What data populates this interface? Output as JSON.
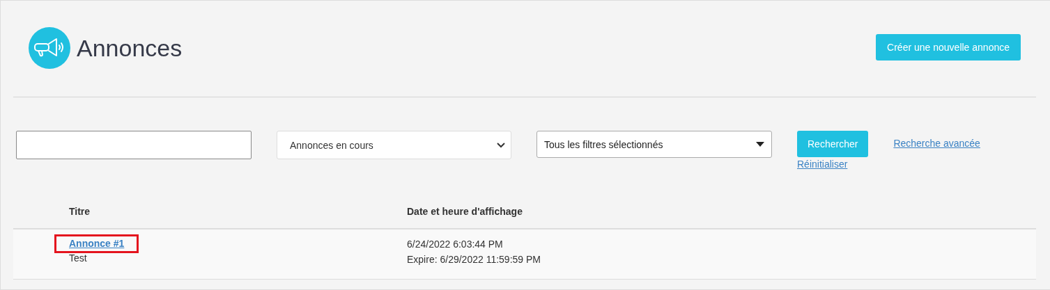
{
  "page": {
    "title": "Annonces",
    "create_button": "Créer une nouvelle annonce"
  },
  "filters": {
    "status_select": {
      "value": "Annonces en cours"
    },
    "filter_select": {
      "value": "Tous les filtres sélectionnés"
    },
    "search_button": "Rechercher",
    "advanced_link": "Recherche avancée",
    "reset_link": "Réinitialiser"
  },
  "table": {
    "columns": [
      "Titre",
      "Date et heure d'affichage"
    ],
    "rows": [
      {
        "title": "Annonce #1",
        "highlighted": true,
        "description": "Test",
        "posted": "6/24/2022 6:03:44 PM",
        "expires": "Expire: 6/29/2022 11:59:59 PM"
      }
    ]
  }
}
